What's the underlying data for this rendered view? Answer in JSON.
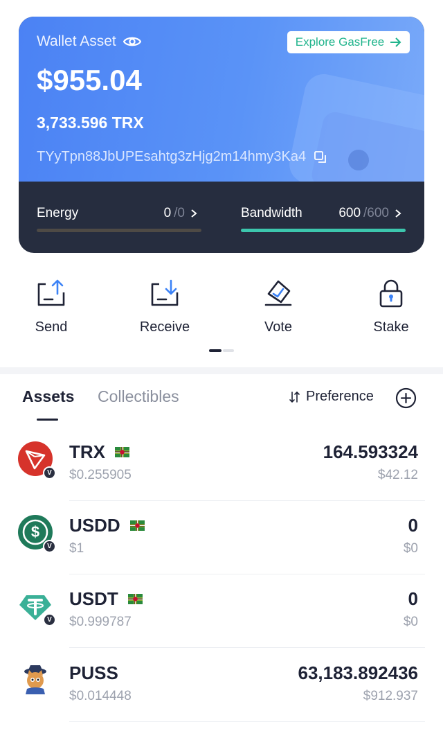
{
  "wallet": {
    "label": "Wallet Asset",
    "explore_label": "Explore GasFree",
    "balance_usd": "$955.04",
    "balance_trx": "3,733.596 TRX",
    "address": "TYyTpn88JbUPEsahtg3zHjg2m14hmy3Ka4"
  },
  "resources": {
    "energy": {
      "label": "Energy",
      "used": "0",
      "total": "/0",
      "fill": 0.0
    },
    "bandwidth": {
      "label": "Bandwidth",
      "used": "600",
      "total": "/600",
      "fill": 1.0
    }
  },
  "actions": [
    {
      "label": "Send",
      "icon": "send-icon"
    },
    {
      "label": "Receive",
      "icon": "receive-icon"
    },
    {
      "label": "Vote",
      "icon": "vote-icon"
    },
    {
      "label": "Stake",
      "icon": "lock-icon"
    }
  ],
  "tabs": {
    "assets": "Assets",
    "collectibles": "Collectibles",
    "preference": "Preference"
  },
  "tokens": [
    {
      "symbol": "TRX",
      "price": "$0.255905",
      "amount": "164.593324",
      "value": "$42.12",
      "verified": true,
      "badge": "V"
    },
    {
      "symbol": "USDD",
      "price": "$1",
      "amount": "0",
      "value": "$0",
      "verified": true,
      "badge": "V"
    },
    {
      "symbol": "USDT",
      "price": "$0.999787",
      "amount": "0",
      "value": "$0",
      "verified": true,
      "badge": "V"
    },
    {
      "symbol": "PUSS",
      "price": "$0.014448",
      "amount": "63,183.892436",
      "value": "$912.937",
      "verified": false
    }
  ],
  "colors": {
    "card_gradient_start": "#4b82f4",
    "card_gradient_end": "#7aaaf9",
    "card_dark": "#262d3f",
    "accent_green": "#20b48c",
    "bandwidth_bar": "#3cc6ad"
  }
}
